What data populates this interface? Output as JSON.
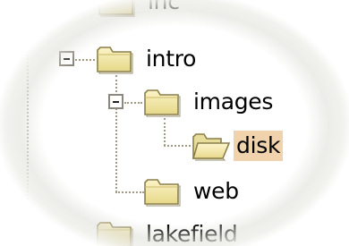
{
  "tree": {
    "nodes": [
      {
        "id": "inc",
        "label": "inc",
        "expanded": false,
        "selected": false,
        "icon": "folder-closed-icon"
      },
      {
        "id": "intro",
        "label": "intro",
        "expanded": true,
        "selected": false,
        "icon": "folder-closed-icon",
        "expander_icon": "minus-icon"
      },
      {
        "id": "images",
        "label": "images",
        "expanded": true,
        "selected": false,
        "icon": "folder-closed-icon",
        "expander_icon": "minus-icon"
      },
      {
        "id": "disk",
        "label": "disk",
        "expanded": false,
        "selected": true,
        "icon": "folder-open-icon"
      },
      {
        "id": "web",
        "label": "web",
        "expanded": false,
        "selected": false,
        "icon": "folder-closed-icon"
      },
      {
        "id": "lakefield",
        "label": "lakefield",
        "expanded": false,
        "selected": false,
        "icon": "folder-closed-icon"
      }
    ]
  },
  "colors": {
    "selection_highlight": "#f0d3ad",
    "folder_yellow": "#f5e9a6",
    "folder_outline": "#8a7f4a",
    "tree_line": "#a29a86",
    "text": "#000000"
  }
}
